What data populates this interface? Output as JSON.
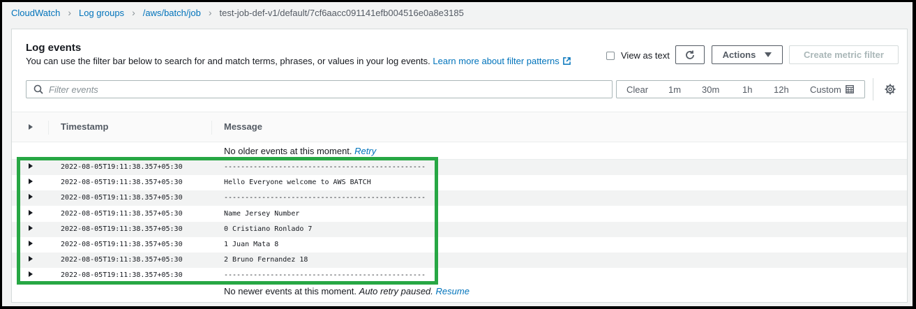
{
  "breadcrumb": {
    "items": [
      "CloudWatch",
      "Log groups",
      "/aws/batch/job"
    ],
    "current": "test-job-def-v1/default/7cf6aacc091141efb004516e0a8e3185"
  },
  "panel": {
    "title": "Log events",
    "description": "You can use the filter bar below to search for and match terms, phrases, or values in your log events.",
    "learn_more": "Learn more about filter patterns",
    "view_as_text": "View as text",
    "actions_label": "Actions",
    "create_metric_filter": "Create metric filter"
  },
  "search": {
    "placeholder": "Filter events"
  },
  "timebar": {
    "clear": "Clear",
    "m1": "1m",
    "m30": "30m",
    "h1": "1h",
    "h12": "12h",
    "custom": "Custom"
  },
  "table": {
    "col_timestamp": "Timestamp",
    "col_message": "Message",
    "no_older": "No older events at this moment.",
    "retry": "Retry",
    "no_newer": "No newer events at this moment.",
    "auto_retry": "Auto retry paused.",
    "resume": "Resume",
    "rows": [
      {
        "timestamp": "2022-08-05T19:11:38.357+05:30",
        "message": "------------------------------------------------"
      },
      {
        "timestamp": "2022-08-05T19:11:38.357+05:30",
        "message": "Hello Everyone welcome to AWS BATCH"
      },
      {
        "timestamp": "2022-08-05T19:11:38.357+05:30",
        "message": "------------------------------------------------"
      },
      {
        "timestamp": "2022-08-05T19:11:38.357+05:30",
        "message": "Name Jersey Number"
      },
      {
        "timestamp": "2022-08-05T19:11:38.357+05:30",
        "message": "0 Cristiano Ronlado 7"
      },
      {
        "timestamp": "2022-08-05T19:11:38.357+05:30",
        "message": "1 Juan Mata 8"
      },
      {
        "timestamp": "2022-08-05T19:11:38.357+05:30",
        "message": "2 Bruno Fernandez 18"
      },
      {
        "timestamp": "2022-08-05T19:11:38.357+05:30",
        "message": "------------------------------------------------"
      }
    ]
  },
  "colors": {
    "link": "#0073bb",
    "highlight": "#27a744"
  },
  "icons": [
    "external-link-icon",
    "refresh-icon",
    "caret-down-icon",
    "search-icon",
    "calendar-icon",
    "gear-icon",
    "expand-row-icon"
  ]
}
